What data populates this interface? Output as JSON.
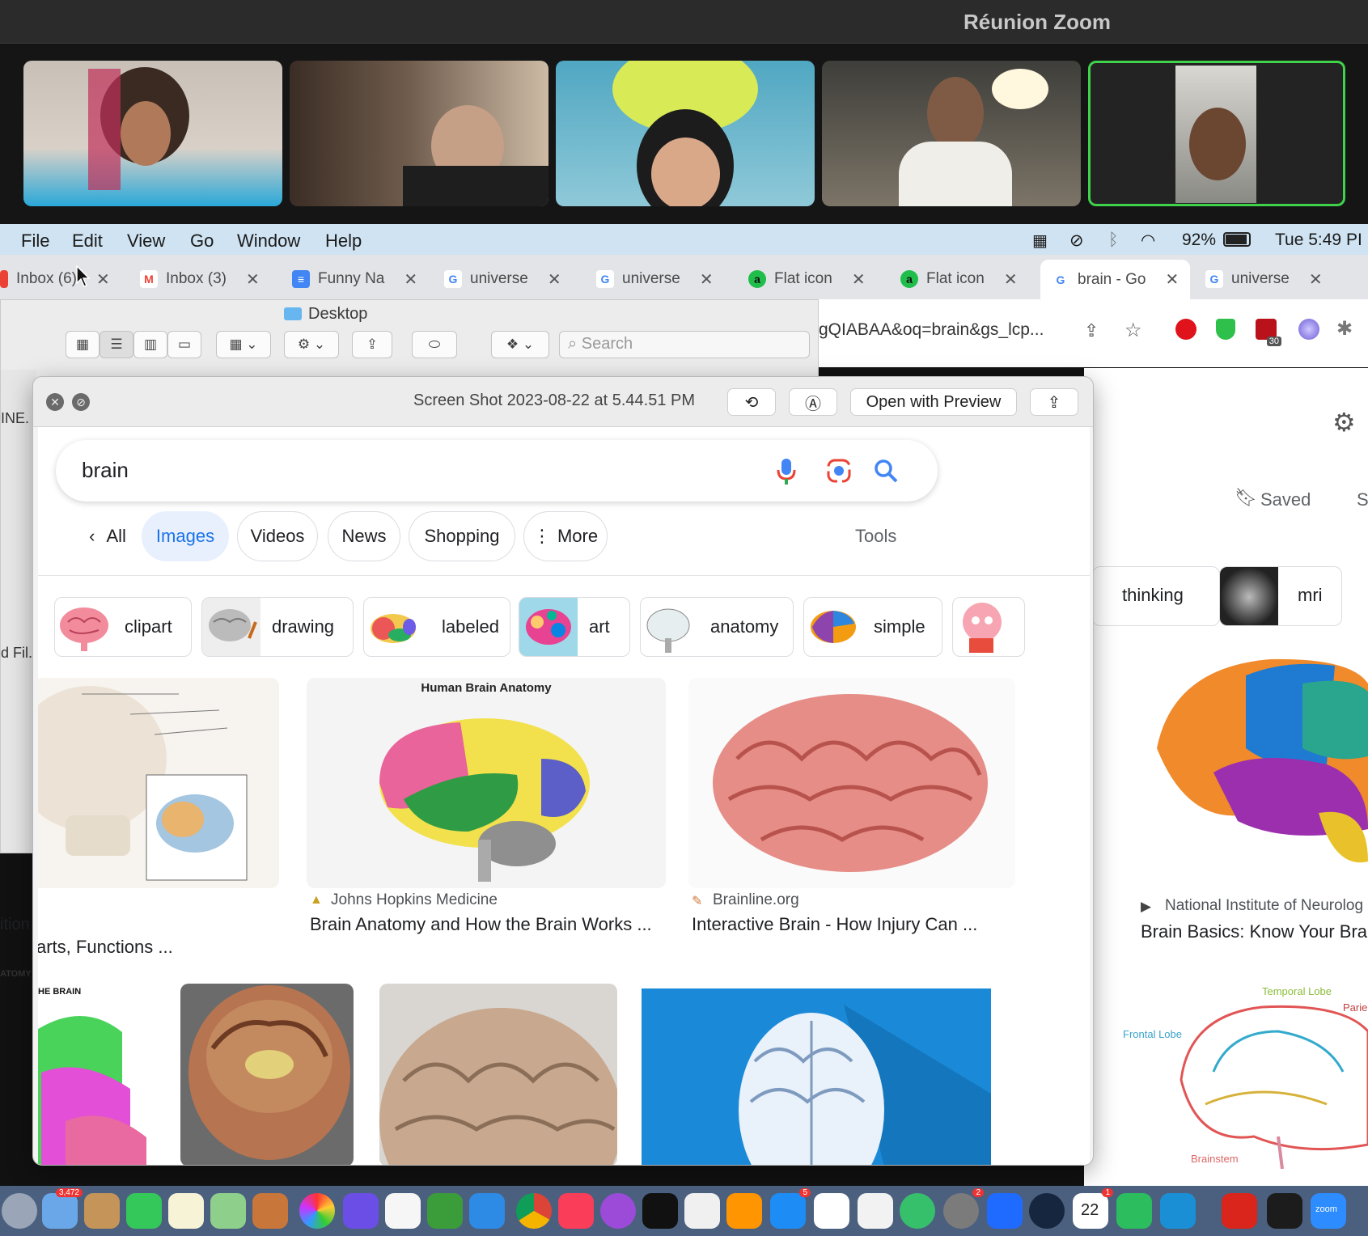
{
  "zoom": {
    "title": "Réunion Zoom"
  },
  "menubar": {
    "items": [
      "File",
      "Edit",
      "View",
      "Go",
      "Window",
      "Help"
    ],
    "battery": "92%",
    "clock": "Tue 5:49 PI"
  },
  "chrome": {
    "tabs": [
      {
        "label": "Inbox (6)",
        "icon": "gmail-icon"
      },
      {
        "label": "Inbox (3)",
        "icon": "gmail-icon"
      },
      {
        "label": "Funny Na",
        "icon": "docs-icon"
      },
      {
        "label": "universe",
        "icon": "google-icon"
      },
      {
        "label": "universe",
        "icon": "google-icon"
      },
      {
        "label": "Flat icon",
        "icon": "flaticon-icon"
      },
      {
        "label": "Flat icon",
        "icon": "flaticon-icon"
      },
      {
        "label": "brain - Go",
        "icon": "google-icon"
      },
      {
        "label": "universe",
        "icon": "google-icon"
      }
    ],
    "omnibox_fragment": "gQIABAA&oq=brain&gs_lcp...",
    "extension_badge": "30"
  },
  "finder": {
    "title": "Desktop",
    "search_placeholder": "Search",
    "fragments": [
      "INE.",
      "d Fil.",
      "ition",
      "ATOMY",
      "HE BRAIN"
    ]
  },
  "quicklook": {
    "title": "Screen Shot 2023-08-22 at 5.44.51 PM",
    "open_with": "Open with Preview"
  },
  "google": {
    "query": "brain",
    "filters": [
      "All",
      "Images",
      "Videos",
      "News",
      "Shopping",
      "More"
    ],
    "tools": "Tools",
    "chips": [
      "clipart",
      "drawing",
      "labeled",
      "art",
      "anatomy",
      "simple"
    ],
    "results": [
      {
        "title": "arts, Functions ..."
      },
      {
        "source": "Johns Hopkins Medicine",
        "title": "Brain Anatomy and How the Brain Works ...",
        "image_caption": "Human Brain Anatomy"
      },
      {
        "source": "Brainline.org",
        "title": "Interactive Brain - How Injury Can ..."
      }
    ]
  },
  "google_right": {
    "saved": "Saved",
    "s_fragment": "S",
    "chips": [
      "thinking",
      "mri"
    ],
    "source": "National Institute of Neurolog",
    "title": "Brain Basics: Know Your Bra",
    "diagram_labels": [
      "Temporal Lobe",
      "Frontal Lobe",
      "Parie",
      "Brainstem"
    ]
  },
  "dock": {
    "badges": [
      "3,472",
      "5",
      "2",
      "1"
    ],
    "calendar_day": "22",
    "zoom_label": "zoom"
  }
}
